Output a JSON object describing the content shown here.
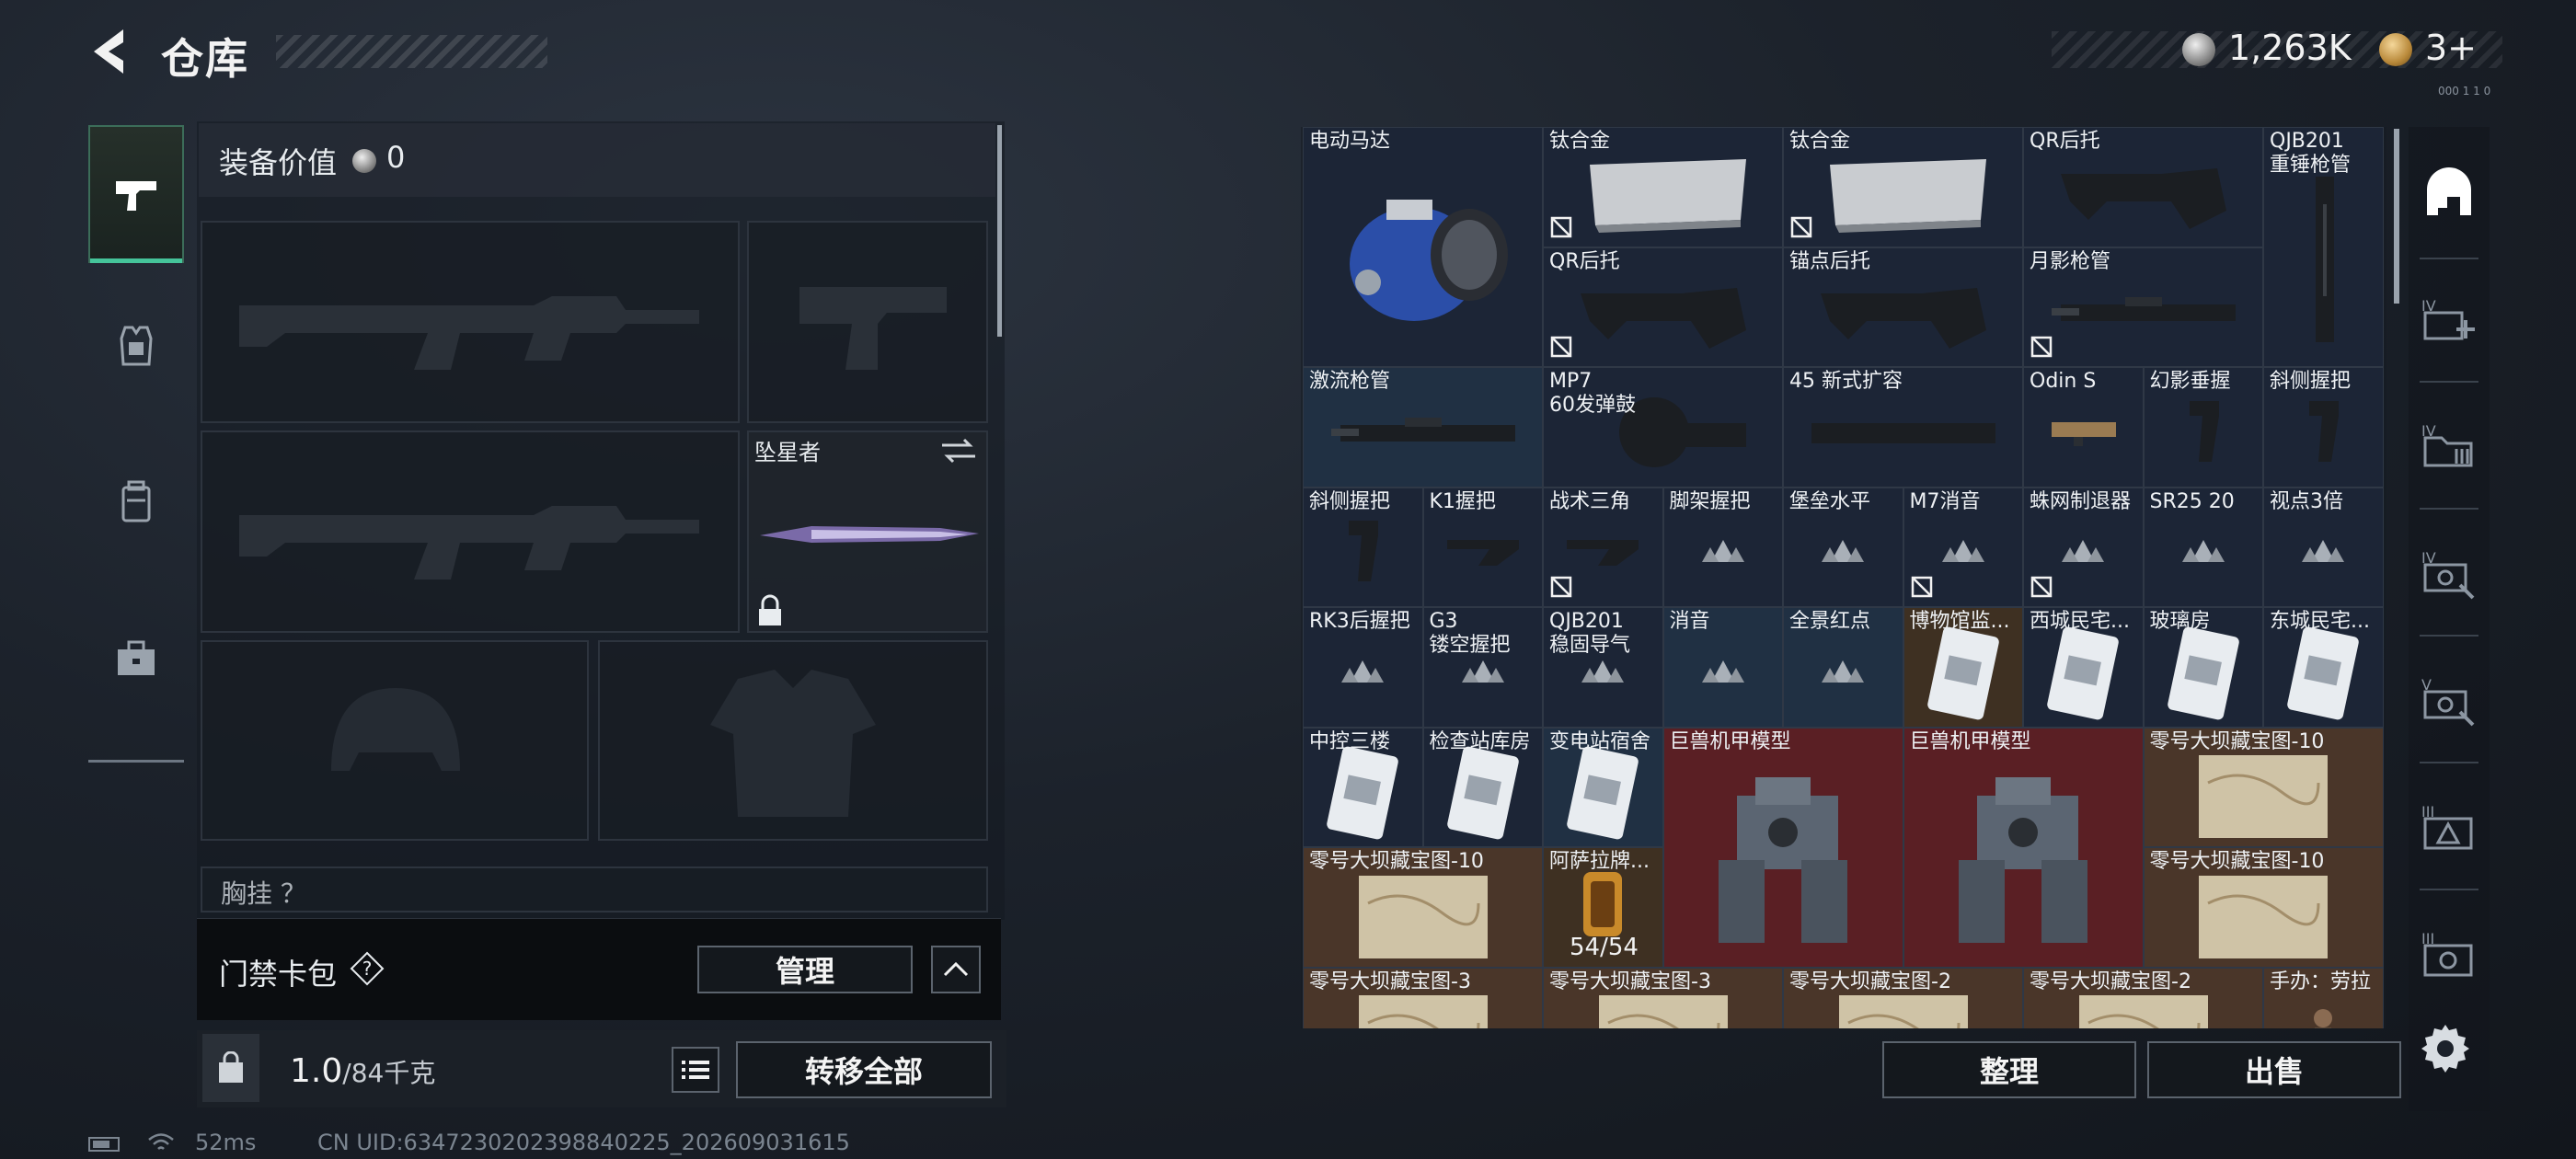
{
  "header": {
    "title": "仓库",
    "money": "1,263K",
    "tickets": "3+",
    "tiny_label": "000 1 1 0"
  },
  "equipment": {
    "value_label": "装备价值",
    "value": "0",
    "melee_name": "坠星者",
    "chest_label": "胸挂 ？"
  },
  "keycard": {
    "label": "门禁卡包",
    "manage": "管理"
  },
  "weight": {
    "current": "1.0",
    "total": "/84千克"
  },
  "actions": {
    "transfer_all": "转移全部",
    "sort": "整理",
    "sell": "出售"
  },
  "status": {
    "ping": "52ms",
    "uid": "CN UID:6347230202398840225_202609031615"
  },
  "storage": {
    "items": [
      {
        "name": "电动马达"
      },
      {
        "name": "钛合金",
        "blocked": true
      },
      {
        "name": "钛合金",
        "blocked": true
      },
      {
        "name": "QR后托"
      },
      {
        "name": "QJB201\n重锤枪管"
      },
      {
        "name": "QR后托",
        "blocked": true
      },
      {
        "name": "锚点后托"
      },
      {
        "name": "月影枪管",
        "blocked": true
      },
      {
        "name": "激流枪管"
      },
      {
        "name": "MP7\n60发弹鼓"
      },
      {
        "name": "45 新式扩容"
      },
      {
        "name": "Odin S"
      },
      {
        "name": "幻影垂握"
      },
      {
        "name": "斜侧握把"
      },
      {
        "name": "斜侧握把"
      },
      {
        "name": "K1握把"
      },
      {
        "name": "战术三角",
        "blocked": true
      },
      {
        "name": "脚架握把"
      },
      {
        "name": "堡垒水平"
      },
      {
        "name": "M7消音",
        "blocked": true
      },
      {
        "name": "蛛网制退器",
        "blocked": true
      },
      {
        "name": "SR25 20"
      },
      {
        "name": "视点3倍"
      },
      {
        "name": "RK3后握把"
      },
      {
        "name": "G3\n镂空握把"
      },
      {
        "name": "QJB201\n稳固导气"
      },
      {
        "name": "消音"
      },
      {
        "name": "全景红点"
      },
      {
        "name": "博物馆监..."
      },
      {
        "name": "西城民宅..."
      },
      {
        "name": "玻璃房"
      },
      {
        "name": "东城民宅..."
      },
      {
        "name": "中控三楼"
      },
      {
        "name": "检查站库房"
      },
      {
        "name": "变电站宿舍"
      },
      {
        "name": "巨兽机甲模型"
      },
      {
        "name": "巨兽机甲模型"
      },
      {
        "name": "零号大坝藏宝图-10"
      },
      {
        "name": "零号大坝藏宝图-10"
      },
      {
        "name": "阿萨拉牌...",
        "count": "54/54"
      },
      {
        "name": "零号大坝藏宝图-10"
      },
      {
        "name": "零号大坝藏宝图-3"
      },
      {
        "name": "零号大坝藏宝图-3"
      },
      {
        "name": "零号大坝藏宝图-2"
      },
      {
        "name": "零号大坝藏宝图-2"
      },
      {
        "name": "手办：劳拉"
      }
    ]
  },
  "colors": {
    "accent": "#45c49a",
    "bg": "#1c222b",
    "cell": "#1e2a3c",
    "rare": "#5a1f24"
  }
}
